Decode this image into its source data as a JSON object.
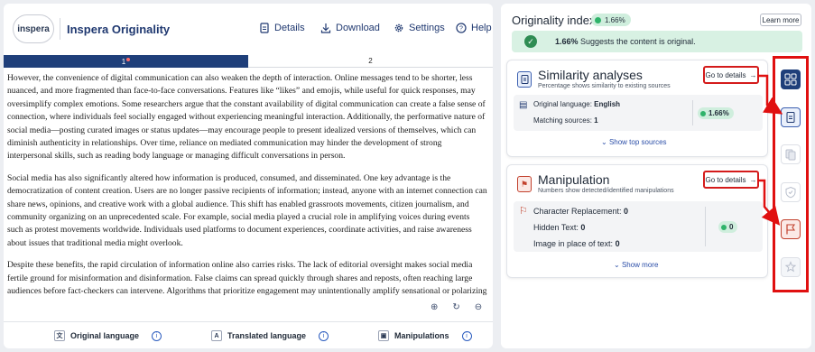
{
  "header": {
    "logo_text": "inspera",
    "brand": "Inspera Originality",
    "details_label": "Details",
    "download_label": "Download",
    "settings_label": "Settings",
    "help_label": "Help"
  },
  "tabs": [
    {
      "label": "1",
      "active": true
    },
    {
      "label": "2",
      "active": false
    }
  ],
  "document": {
    "paragraphs": [
      "However, the convenience of digital communication can also weaken the depth of interaction. Online messages tend to be shorter, less nuanced, and more fragmented than face-to-face conversations. Features like “likes” and emojis, while useful for quick responses, may oversimplify complex emotions. Some researchers argue that the constant availability of digital communication can create a false sense of connection, where individuals feel socially engaged without experiencing meaningful interaction. Additionally, the performative nature of social media—posting curated images or status updates—may encourage people to present idealized versions of themselves, which can diminish authenticity in relationships. Over time, reliance on mediated communication may hinder the development of strong interpersonal skills, such as reading body language or managing difficult conversations in person.",
      "Social media has also significantly altered how information is produced, consumed, and disseminated. One key advantage is the democratization of content creation. Users are no longer passive recipients of information; instead, anyone with an internet connection can share news, opinions, and creative work with a global audience. This shift has enabled grassroots movements, citizen journalism, and community organizing on an unprecedented scale. For example, social media played a crucial role in amplifying voices during events such as protest movements worldwide. Individuals used platforms to document experiences, coordinate activities, and raise awareness about issues that traditional media might overlook.",
      "Despite these benefits, the rapid circulation of information online also carries risks. The lack of editorial oversight makes social media fertile ground for misinformation and disinformation. False claims can spread quickly through shares and reposts, often reaching large audiences before fact-checkers can intervene. Algorithms that prioritize engagement may unintentionally amplify sensational or polarizing content, leading users to encounter information that reinforces their existing beliefs. This phenomenon, sometimes described as an “echo"
    ]
  },
  "footer": {
    "original_language": "Original language",
    "translated_language": "Translated language",
    "manipulations": "Manipulations"
  },
  "originality": {
    "title": "Originality index",
    "score": "1.66%",
    "learn_more": "Learn more",
    "banner_score": "1.66%",
    "banner_text": " Suggests the content is original."
  },
  "similarity": {
    "title": "Similarity analyses",
    "subtitle": "Percentage shows similarity to existing sources",
    "goto_label": "Go to details",
    "original_language_label": "Original language: ",
    "original_language_value": "English",
    "matching_sources_label": "Matching sources: ",
    "matching_sources_value": "1",
    "score": "1.66%",
    "show_label": "Show top sources"
  },
  "manipulation": {
    "title": "Manipulation",
    "subtitle": "Numbers show detected/identified manipulations",
    "goto_label": "Go to details",
    "char_label": "Character Replacement: ",
    "char_value": "0",
    "hidden_label": "Hidden Text: ",
    "hidden_value": "0",
    "image_label": "Image in place of text: ",
    "image_value": "0",
    "score": "0",
    "show_label": "Show more"
  },
  "colors": {
    "brand": "#1f3870",
    "accent_green": "#2fb36a",
    "highlight_red": "#e01010"
  }
}
